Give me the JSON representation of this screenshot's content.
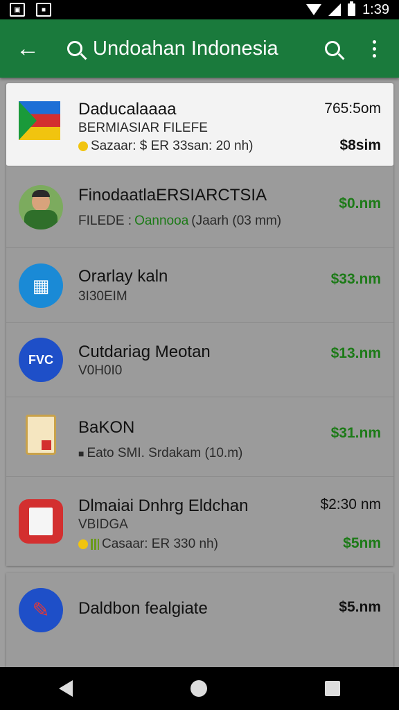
{
  "status_bar": {
    "time": "1:39",
    "left_icons": [
      "image-notification-icon",
      "app-notification-icon"
    ]
  },
  "app_bar": {
    "title": "Undoahan Indonesia",
    "icons": [
      "back-arrow-icon",
      "search-icon",
      "search-icon",
      "more-vert-icon"
    ]
  },
  "items": [
    {
      "title": "Daducalaaaa",
      "subtitle": "BERMIASIAR FILEFE",
      "meta_text": "Sazaar: $ ER 33san: 20 nh)",
      "price_top": "765:5om",
      "price_bottom": "$8sim",
      "icon": "flag-icon"
    },
    {
      "title": "FinodaatlaERSIARCTSIA",
      "subtitle_prefix": "FILEDE :",
      "subtitle_green": "Oannooa",
      "subtitle_suffix": "(Jaarh (03 mm)",
      "price": "$0.nm",
      "icon": "person-avatar"
    },
    {
      "title": "Orarlay kaln",
      "subtitle": "3I30EIM",
      "price": "$33.nm",
      "icon": "app-grid-icon"
    },
    {
      "title": "Cutdariag Meotan",
      "subtitle": "V0H0I0",
      "price": "$13.nm",
      "icon": "fvc-logo",
      "icon_text": "FVC"
    },
    {
      "title": "BaKON",
      "meta_text": "Eato SMI. Srdakam (10.m)",
      "price": "$31.nm",
      "icon": "document-icon"
    },
    {
      "title": "Dlmaiai Dnhrg Eldchan",
      "subtitle": "VBIDGA",
      "meta_text": "Casaar: ER 330 nh)",
      "price_top": "$2:30 nm",
      "price_bottom": "$5nm",
      "icon": "document-red-icon"
    },
    {
      "title": "Daldbon fealgiate",
      "price": "$5.nm",
      "icon": "pen-icon"
    }
  ],
  "colors": {
    "app_bar": "#1a7a3c",
    "price_green": "#1c7a17",
    "fvc_blue": "#1e4fc8",
    "grid_blue": "#1a8ad6",
    "doc_red": "#d32f2f"
  }
}
